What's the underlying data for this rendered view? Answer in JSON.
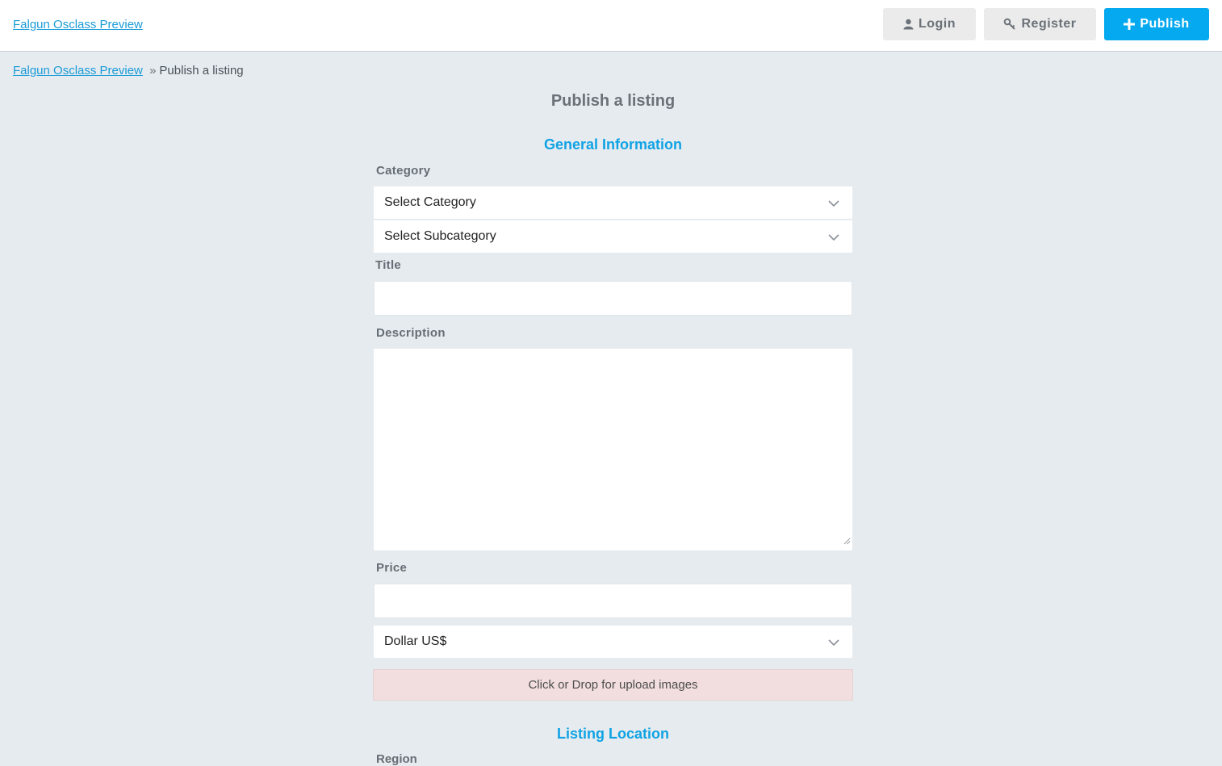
{
  "header": {
    "brand": "Falgun Osclass Preview",
    "login_label": "Login",
    "register_label": "Register",
    "publish_label": "Publish"
  },
  "breadcrumb": {
    "home": "Falgun Osclass Preview",
    "separator": "»",
    "current": "Publish a listing"
  },
  "page": {
    "title": "Publish a listing"
  },
  "general_info": {
    "heading": "General Information",
    "category_label": "Category",
    "category_value": "Select Category",
    "subcategory_value": "Select Subcategory",
    "title_label": "Title",
    "title_value": "",
    "description_label": "Description",
    "description_value": "",
    "price_label": "Price",
    "price_value": "",
    "currency_value": "Dollar US$",
    "upload_text": "Click or Drop for upload images"
  },
  "listing_location": {
    "heading": "Listing Location",
    "region_label_partial": "Region"
  },
  "colors": {
    "accent": "#04a9f0",
    "link": "#1a9bd7",
    "background": "#e6ebef",
    "upload_bg": "#f2dede"
  },
  "icons": {
    "login": "user-icon",
    "register": "key-icon",
    "publish": "plus-icon",
    "select": "chevron-down-icon"
  }
}
